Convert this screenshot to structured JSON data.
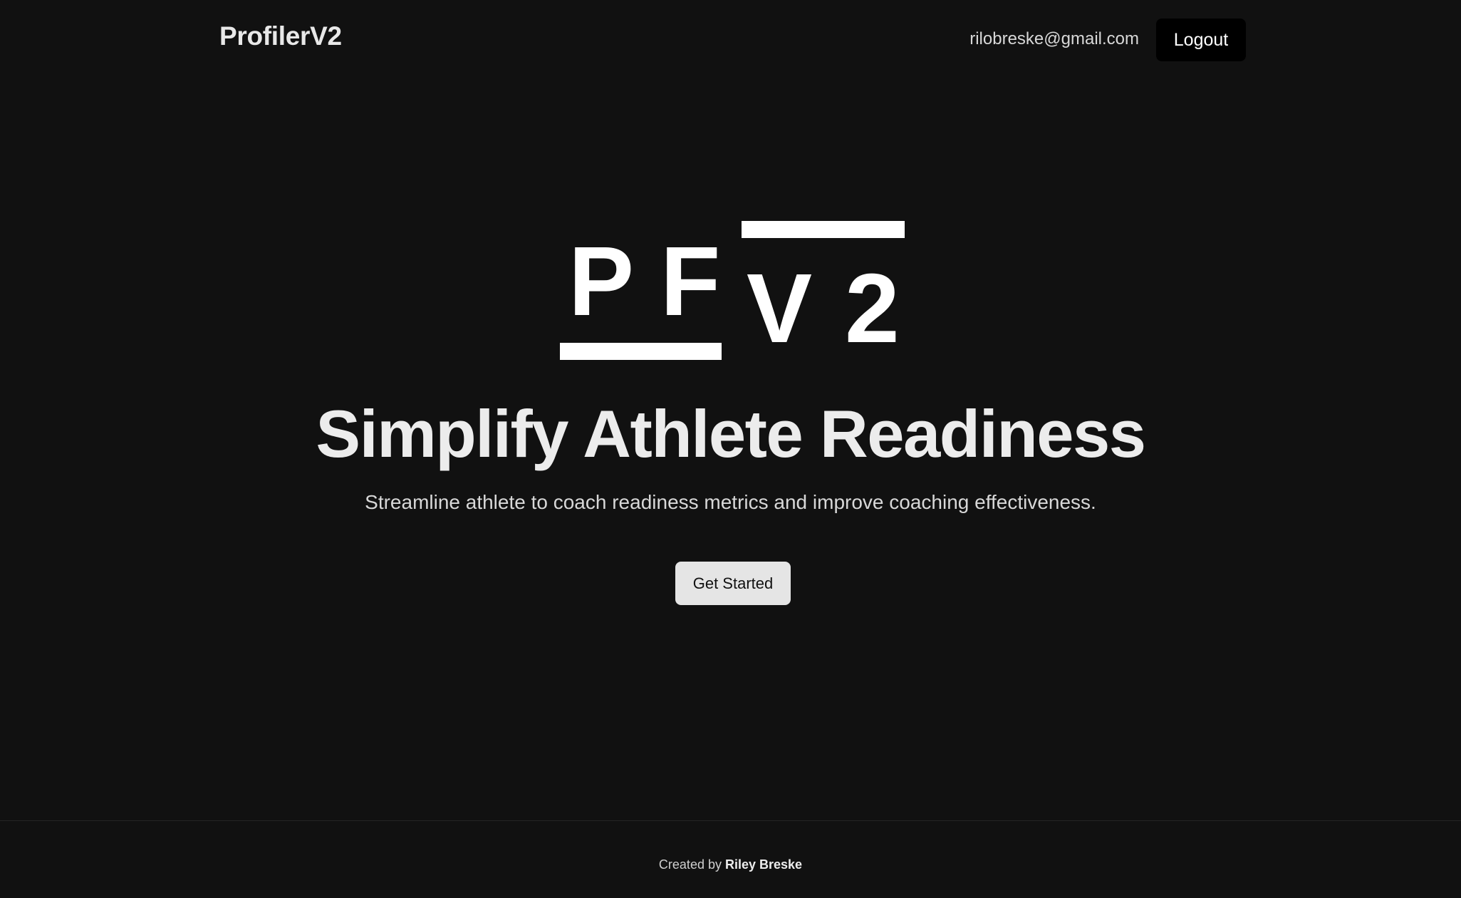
{
  "header": {
    "brand": "ProfilerV2",
    "user_email": "rilobreske@gmail.com",
    "logout_label": "Logout"
  },
  "hero": {
    "logo": {
      "letter_p": "P",
      "letter_f": "F",
      "letter_v": "V",
      "letter_2": "2"
    },
    "headline": "Simplify Athlete Readiness",
    "subheadline": "Streamline athlete to coach readiness metrics and improve coaching effectiveness.",
    "cta_label": "Get Started"
  },
  "footer": {
    "created_by_prefix": "Created by",
    "author": "Riley Breske"
  },
  "colors": {
    "background": "#111111",
    "text": "#e8e8e8",
    "logout_button": "#000000",
    "cta_button": "#e5e5e5"
  }
}
